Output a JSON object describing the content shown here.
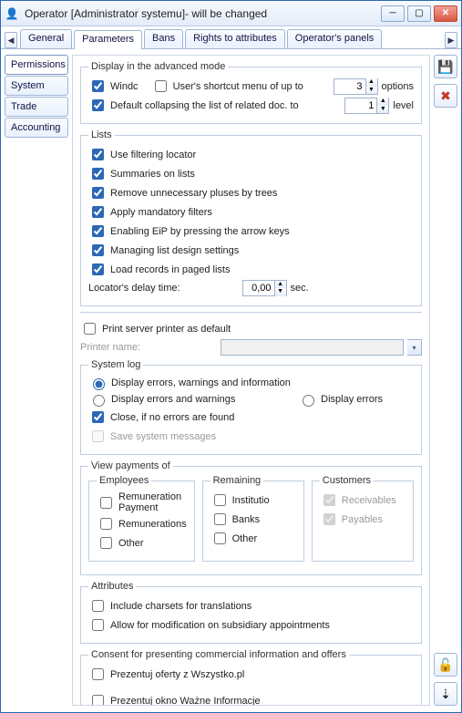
{
  "window": {
    "title": "Operator [Administrator systemu]- will be changed"
  },
  "tabs": {
    "items": [
      "General",
      "Parameters",
      "Bans",
      "Rights to attributes",
      "Operator's panels"
    ],
    "active": 1
  },
  "side_tabs": {
    "items": [
      "Permissions",
      "System",
      "Trade",
      "Accounting"
    ],
    "active": 0
  },
  "toolbar": {
    "save": "save",
    "cancel": "cancel",
    "unlock": "unlock",
    "down": "down"
  },
  "display_mode": {
    "legend": "Display in the advanced mode",
    "windc": "Windc",
    "shortcut_menu": "User's shortcut menu of up to",
    "options_value": "3",
    "options_label": "options",
    "collapse": "Default collapsing the list of related doc. to",
    "level_value": "1",
    "level_label": "level"
  },
  "lists": {
    "legend": "Lists",
    "use_filtering": "Use filtering locator",
    "summaries": "Summaries on lists",
    "remove_pluses": "Remove unnecessary pluses by trees",
    "mandatory_filters": "Apply mandatory filters",
    "enable_eip": "Enabling EiP by pressing the arrow keys",
    "managing_design": "Managing list design settings",
    "load_paged": "Load records in paged lists",
    "delay_label": "Locator's delay time:",
    "delay_value": "0,00",
    "delay_unit": "sec."
  },
  "printer": {
    "use_default": "Print server printer as default",
    "name_label": "Printer name:"
  },
  "syslog": {
    "legend": "System log",
    "opt_all": "Display errors, warnings and information",
    "opt_ew": "Display errors and warnings",
    "opt_e": "Display errors",
    "close_none": "Close, if no errors are found",
    "save_msgs": "Save system messages"
  },
  "view_payments": {
    "legend": "View payments of",
    "employees": {
      "legend": "Employees",
      "remun_payment": "Remuneration Payment",
      "remunerations": "Remunerations",
      "other": "Other"
    },
    "remaining": {
      "legend": "Remaining",
      "institutio": "Institutio",
      "banks": "Banks",
      "other": "Other"
    },
    "customers": {
      "legend": "Customers",
      "receivables": "Receivables",
      "payables": "Payables"
    }
  },
  "attributes": {
    "legend": "Attributes",
    "charsets": "Include charsets for translations",
    "subsidiary": "Allow for modification on subsidiary appointments"
  },
  "consent": {
    "legend": "Consent for presenting commercial information and offers",
    "wszystko": "Prezentuj oferty z Wszystko.pl",
    "wazne": "Prezentuj okno Ważne Informacje"
  }
}
